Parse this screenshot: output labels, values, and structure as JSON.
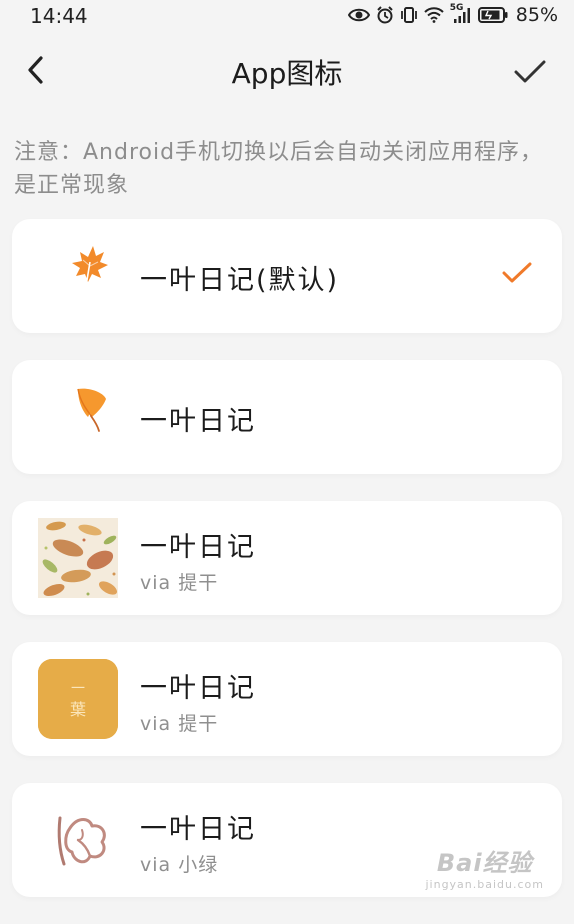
{
  "status_bar": {
    "time": "14:44",
    "network": "5G",
    "battery": "85%"
  },
  "header": {
    "title": "App图标",
    "back_icon": "chevron-left-icon",
    "confirm_icon": "check-icon"
  },
  "notice": "注意：Android手机切换以后会自动关闭应用程序，是正常现象",
  "accent_color": "#f07a2a",
  "icons": [
    {
      "name": "一叶日记(默认)",
      "credit": "",
      "selected": true,
      "icon": "orange-maple-leaf-icon"
    },
    {
      "name": "一叶日记",
      "credit": "",
      "selected": false,
      "icon": "orange-ginkgo-leaf-icon"
    },
    {
      "name": "一叶日记",
      "credit": "via 提干",
      "selected": false,
      "icon": "falling-leaves-pattern-icon"
    },
    {
      "name": "一叶日记",
      "credit": "via 提干",
      "selected": false,
      "icon": "yellow-leaf-character-icon"
    },
    {
      "name": "一叶日记",
      "credit": "via 小绿",
      "selected": false,
      "icon": "sketch-leaf-icon"
    }
  ],
  "yellow_icon_text": {
    "top": "一",
    "bottom": "葉"
  },
  "watermark": {
    "top": "Bai经验",
    "bottom": "jingyan.baidu.com"
  }
}
